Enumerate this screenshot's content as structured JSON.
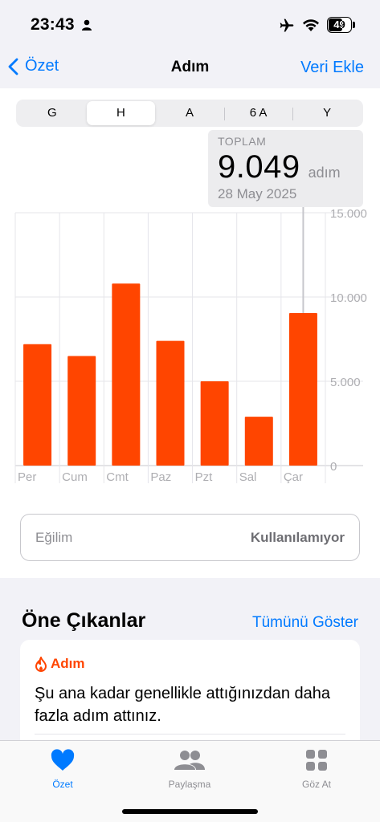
{
  "status_bar": {
    "time": "23:43",
    "battery": "49"
  },
  "nav": {
    "back_label": "Özet",
    "title": "Adım",
    "action_label": "Veri Ekle"
  },
  "segments": [
    {
      "label": "G",
      "active": false
    },
    {
      "label": "H",
      "active": true
    },
    {
      "label": "A",
      "active": false
    },
    {
      "label": "6 A",
      "active": false
    },
    {
      "label": "Y",
      "active": false
    }
  ],
  "tooltip": {
    "label": "TOPLAM",
    "value": "9.049",
    "unit": "adım",
    "date": "28 May 2025"
  },
  "chart_data": {
    "type": "bar",
    "categories": [
      "Per",
      "Cum",
      "Cmt",
      "Paz",
      "Pzt",
      "Sal",
      "Çar"
    ],
    "values": [
      7200,
      6500,
      10800,
      7400,
      5000,
      2900,
      9049
    ],
    "y_ticks": [
      "15.000",
      "10.000",
      "5.000",
      "0"
    ],
    "ylim": [
      0,
      15000
    ],
    "selected_index": 6,
    "bar_color": "#ff4500",
    "grid": true
  },
  "trend": {
    "label": "Eğilim",
    "status": "Kullanılamıyor"
  },
  "highlights": {
    "title": "Öne Çıkanlar",
    "show_all": "Tümünü Göster",
    "card": {
      "category": "Adım",
      "text": "Şu ana kadar genellikle attığınızdan daha fazla adım attınız."
    }
  },
  "tabs": [
    {
      "label": "Özet",
      "icon": "heart-icon",
      "active": true
    },
    {
      "label": "Paylaşma",
      "icon": "people-icon",
      "active": false
    },
    {
      "label": "Göz At",
      "icon": "grid-icon",
      "active": false
    }
  ],
  "colors": {
    "accent": "#007aff",
    "steps": "#ff4500"
  }
}
